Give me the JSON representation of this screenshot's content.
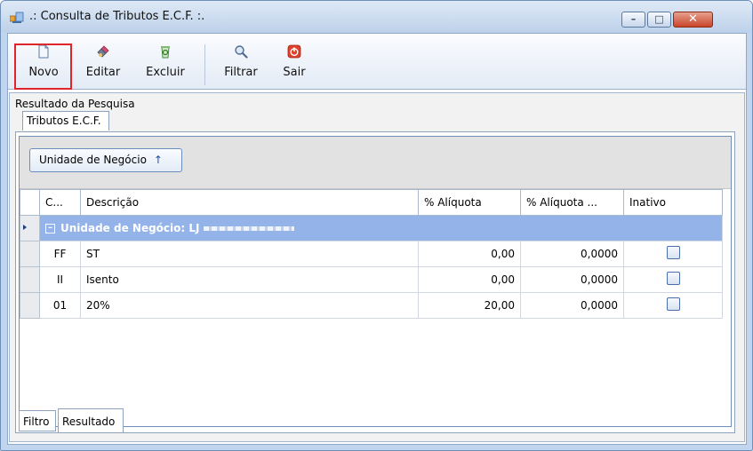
{
  "window": {
    "title": ".: Consulta de Tributos E.C.F. :.",
    "controls": {
      "minimize": "–",
      "maximize": "□",
      "close": "✕"
    }
  },
  "toolbar": {
    "buttons": [
      {
        "label": "Novo",
        "icon": "new-document-icon"
      },
      {
        "label": "Editar",
        "icon": "edit-brush-icon"
      },
      {
        "label": "Excluir",
        "icon": "delete-recycle-icon"
      },
      {
        "label": "Filtrar",
        "icon": "magnifier-icon"
      },
      {
        "label": "Sair",
        "icon": "power-exit-icon"
      }
    ]
  },
  "results": {
    "group_label": "Resultado da Pesquisa",
    "tab_label": "Tributos E.C.F.",
    "grouping_chip": "Unidade de Negócio",
    "grouping_arrow": "↑",
    "columns": [
      "C...",
      "Descrição",
      "% Alíquota",
      "% Alíquota ...",
      "Inativo"
    ],
    "group_row": {
      "label": "Unidade de Negócio: LJ"
    },
    "rows": [
      {
        "code": "FF",
        "descricao": "ST",
        "aliquota": "0,00",
        "aliquota2": "0,0000",
        "inativo": false
      },
      {
        "code": "II",
        "descricao": "Isento",
        "aliquota": "0,00",
        "aliquota2": "0,0000",
        "inativo": false
      },
      {
        "code": "01",
        "descricao": "20%",
        "aliquota": "20,00",
        "aliquota2": "0,0000",
        "inativo": false
      }
    ]
  },
  "bottom_tabs": [
    {
      "label": "Filtro"
    },
    {
      "label": "Resultado"
    }
  ],
  "colors": {
    "group_row_bg": "#94b3e8",
    "highlight_border": "#e0252a",
    "window_frame": "#c2d5ee"
  }
}
